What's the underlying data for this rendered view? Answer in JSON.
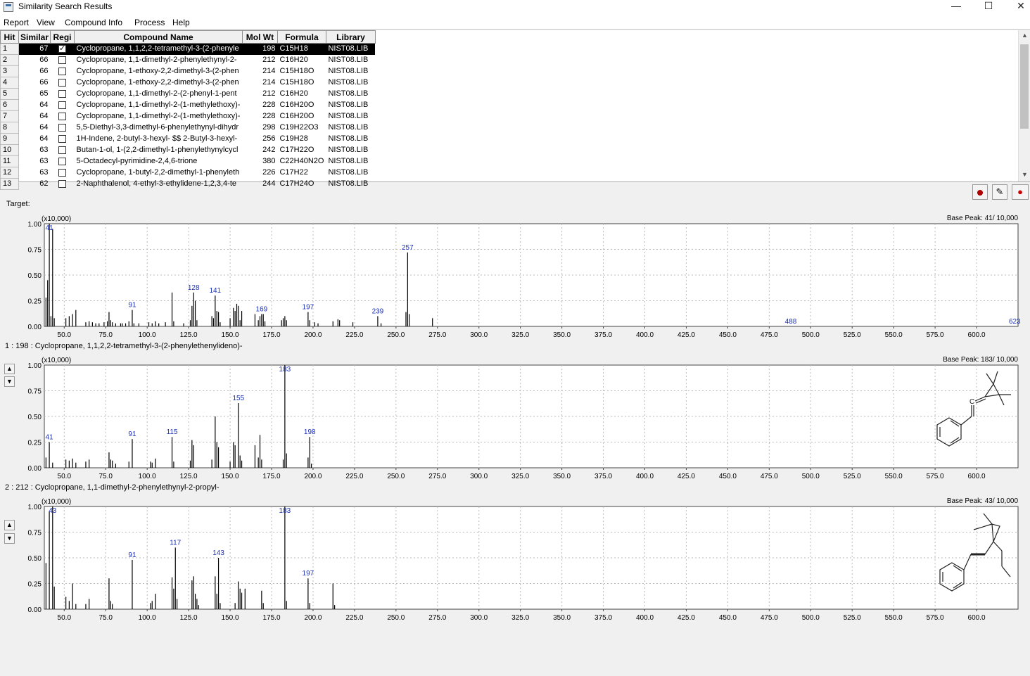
{
  "window": {
    "title": "Similarity Search Results",
    "minimize": "—",
    "maximize": "☐",
    "close": "✕"
  },
  "menu": [
    "Report",
    "View",
    "Compound Info",
    "Process",
    "Help"
  ],
  "table": {
    "columns": [
      "Hit",
      "Similar",
      "Regi",
      "Compound Name",
      "Mol Wt",
      "Formula",
      "Library"
    ],
    "rows": [
      {
        "hit": "1",
        "sim": "67",
        "reg": true,
        "name": "Cyclopropane, 1,1,2,2-tetramethyl-3-(2-phenyle",
        "mw": "198",
        "formula": "C15H18",
        "lib": "NIST08.LIB"
      },
      {
        "hit": "2",
        "sim": "66",
        "reg": false,
        "name": "Cyclopropane, 1,1-dimethyl-2-phenylethynyl-2-",
        "mw": "212",
        "formula": "C16H20",
        "lib": "NIST08.LIB"
      },
      {
        "hit": "3",
        "sim": "66",
        "reg": false,
        "name": "Cyclopropane, 1-ethoxy-2,2-dimethyl-3-(2-phen",
        "mw": "214",
        "formula": "C15H18O",
        "lib": "NIST08.LIB"
      },
      {
        "hit": "4",
        "sim": "66",
        "reg": false,
        "name": "Cyclopropane, 1-ethoxy-2,2-dimethyl-3-(2-phen",
        "mw": "214",
        "formula": "C15H18O",
        "lib": "NIST08.LIB"
      },
      {
        "hit": "5",
        "sim": "65",
        "reg": false,
        "name": "Cyclopropane, 1,1-dimethyl-2-(2-phenyl-1-pent",
        "mw": "212",
        "formula": "C16H20",
        "lib": "NIST08.LIB"
      },
      {
        "hit": "6",
        "sim": "64",
        "reg": false,
        "name": "Cyclopropane, 1,1-dimethyl-2-(1-methylethoxy)-",
        "mw": "228",
        "formula": "C16H20O",
        "lib": "NIST08.LIB"
      },
      {
        "hit": "7",
        "sim": "64",
        "reg": false,
        "name": "Cyclopropane, 1,1-dimethyl-2-(1-methylethoxy)-",
        "mw": "228",
        "formula": "C16H20O",
        "lib": "NIST08.LIB"
      },
      {
        "hit": "8",
        "sim": "64",
        "reg": false,
        "name": "5,5-Diethyl-3,3-dimethyl-6-phenylethynyl-dihydr",
        "mw": "298",
        "formula": "C19H22O3",
        "lib": "NIST08.LIB"
      },
      {
        "hit": "9",
        "sim": "64",
        "reg": false,
        "name": "1H-Indene, 2-butyl-3-hexyl- $$ 2-Butyl-3-hexyl-",
        "mw": "256",
        "formula": "C19H28",
        "lib": "NIST08.LIB"
      },
      {
        "hit": "10",
        "sim": "63",
        "reg": false,
        "name": "Butan-1-ol, 1-(2,2-dimethyl-1-phenylethynylcycl",
        "mw": "242",
        "formula": "C17H22O",
        "lib": "NIST08.LIB"
      },
      {
        "hit": "11",
        "sim": "63",
        "reg": false,
        "name": "5-Octadecyl-pyrimidine-2,4,6-trione",
        "mw": "380",
        "formula": "C22H40N2O",
        "lib": "NIST08.LIB"
      },
      {
        "hit": "12",
        "sim": "63",
        "reg": false,
        "name": "Cyclopropane, 1-butyl-2,2-dimethyl-1-phenyleth",
        "mw": "226",
        "formula": "C17H22",
        "lib": "NIST08.LIB"
      },
      {
        "hit": "13",
        "sim": "62",
        "reg": false,
        "name": "2-Naphthalenol, 4-ethyl-3-ethylidene-1,2,3,4-te",
        "mw": "244",
        "formula": "C17H24O",
        "lib": "NIST08.LIB"
      }
    ]
  },
  "toolbar_icons": [
    "record-icon",
    "edit-icon",
    "molecule-color-icon"
  ],
  "target_label": "Target:",
  "hit1_label": "1 : 198 : Cyclopropane, 1,1,2,2-tetramethyl-3-(2-phenylethenylideno)-",
  "hit2_label": "2 : 212 : Cyclopropane, 1,1-dimethyl-2-phenylethynyl-2-propyl-",
  "chart_data": [
    {
      "type": "bar",
      "name": "target",
      "scale_label": "(x10,000)",
      "base_peak": "Base Peak: 41/ 10,000",
      "xlim": [
        38,
        625
      ],
      "ylim": [
        0,
        1
      ],
      "xticks": [
        "50.0",
        "75.0",
        "100.0",
        "125.0",
        "150.0",
        "175.0",
        "200.0",
        "225.0",
        "250.0",
        "275.0",
        "300.0",
        "325.0",
        "350.0",
        "375.0",
        "400.0",
        "425.0",
        "450.0",
        "475.0",
        "500.0",
        "525.0",
        "550.0",
        "575.0",
        "600.0"
      ],
      "yticks": [
        "0.00",
        "0.25",
        "0.50",
        "0.75",
        "1.00"
      ],
      "peaks": [
        [
          39,
          0.28
        ],
        [
          40,
          0.45
        ],
        [
          41,
          1.0
        ],
        [
          42,
          0.1
        ],
        [
          43,
          0.95
        ],
        [
          44,
          0.08
        ],
        [
          51,
          0.08
        ],
        [
          53,
          0.1
        ],
        [
          55,
          0.12
        ],
        [
          57,
          0.16
        ],
        [
          63,
          0.04
        ],
        [
          65,
          0.05
        ],
        [
          67,
          0.04
        ],
        [
          69,
          0.03
        ],
        [
          71,
          0.03
        ],
        [
          74,
          0.04
        ],
        [
          76,
          0.05
        ],
        [
          77,
          0.14
        ],
        [
          78,
          0.06
        ],
        [
          79,
          0.04
        ],
        [
          81,
          0.03
        ],
        [
          84,
          0.03
        ],
        [
          85,
          0.03
        ],
        [
          87,
          0.03
        ],
        [
          89,
          0.05
        ],
        [
          91,
          0.16
        ],
        [
          92,
          0.03
        ],
        [
          95,
          0.03
        ],
        [
          101,
          0.04
        ],
        [
          103,
          0.03
        ],
        [
          105,
          0.05
        ],
        [
          107,
          0.03
        ],
        [
          111,
          0.04
        ],
        [
          115,
          0.33
        ],
        [
          116,
          0.05
        ],
        [
          122,
          0.03
        ],
        [
          126,
          0.06
        ],
        [
          127,
          0.2
        ],
        [
          128,
          0.33
        ],
        [
          129,
          0.25
        ],
        [
          130,
          0.06
        ],
        [
          139,
          0.1
        ],
        [
          140,
          0.08
        ],
        [
          141,
          0.3
        ],
        [
          142,
          0.15
        ],
        [
          143,
          0.14
        ],
        [
          144,
          0.04
        ],
        [
          150,
          0.08
        ],
        [
          152,
          0.18
        ],
        [
          153,
          0.15
        ],
        [
          154,
          0.22
        ],
        [
          155,
          0.2
        ],
        [
          156,
          0.06
        ],
        [
          157,
          0.15
        ],
        [
          165,
          0.12
        ],
        [
          167,
          0.06
        ],
        [
          168,
          0.1
        ],
        [
          169,
          0.12
        ],
        [
          170,
          0.12
        ],
        [
          171,
          0.05
        ],
        [
          181,
          0.06
        ],
        [
          182,
          0.08
        ],
        [
          183,
          0.1
        ],
        [
          184,
          0.06
        ],
        [
          197,
          0.14
        ],
        [
          198,
          0.06
        ],
        [
          201,
          0.04
        ],
        [
          203,
          0.03
        ],
        [
          212,
          0.05
        ],
        [
          215,
          0.07
        ],
        [
          216,
          0.06
        ],
        [
          224,
          0.04
        ],
        [
          239,
          0.1
        ],
        [
          241,
          0.03
        ],
        [
          256,
          0.14
        ],
        [
          257,
          0.72
        ],
        [
          258,
          0.12
        ],
        [
          272,
          0.08
        ]
      ],
      "annotations": [
        {
          "x": 41,
          "y": 1.0,
          "label": "41"
        },
        {
          "x": 91,
          "y": 0.16,
          "label": "91"
        },
        {
          "x": 128,
          "y": 0.33,
          "label": "128"
        },
        {
          "x": 141,
          "y": 0.3,
          "label": "141"
        },
        {
          "x": 169,
          "y": 0.12,
          "label": "169"
        },
        {
          "x": 197,
          "y": 0.14,
          "label": "197"
        },
        {
          "x": 239,
          "y": 0.1,
          "label": "239"
        },
        {
          "x": 257,
          "y": 0.72,
          "label": "257"
        },
        {
          "x": 488,
          "y": 0.0,
          "label": "488"
        },
        {
          "x": 623,
          "y": 0.0,
          "label": "623"
        }
      ]
    },
    {
      "type": "bar",
      "name": "hit1",
      "scale_label": "(x10,000)",
      "base_peak": "Base Peak: 183/ 10,000",
      "xlim": [
        38,
        625
      ],
      "ylim": [
        0,
        1
      ],
      "xticks": [
        "50.0",
        "75.0",
        "100.0",
        "125.0",
        "150.0",
        "175.0",
        "200.0",
        "225.0",
        "250.0",
        "275.0",
        "300.0",
        "325.0",
        "350.0",
        "375.0",
        "400.0",
        "425.0",
        "450.0",
        "475.0",
        "500.0",
        "525.0",
        "550.0",
        "575.0",
        "600.0"
      ],
      "yticks": [
        "0.00",
        "0.25",
        "0.50",
        "0.75",
        "1.00"
      ],
      "peaks": [
        [
          39,
          0.1
        ],
        [
          41,
          0.25
        ],
        [
          43,
          0.05
        ],
        [
          51,
          0.08
        ],
        [
          53,
          0.07
        ],
        [
          55,
          0.09
        ],
        [
          57,
          0.05
        ],
        [
          63,
          0.06
        ],
        [
          65,
          0.08
        ],
        [
          77,
          0.15
        ],
        [
          78,
          0.08
        ],
        [
          79,
          0.07
        ],
        [
          81,
          0.04
        ],
        [
          89,
          0.06
        ],
        [
          91,
          0.28
        ],
        [
          102,
          0.06
        ],
        [
          103,
          0.05
        ],
        [
          105,
          0.09
        ],
        [
          115,
          0.3
        ],
        [
          116,
          0.06
        ],
        [
          126,
          0.07
        ],
        [
          127,
          0.27
        ],
        [
          128,
          0.22
        ],
        [
          139,
          0.08
        ],
        [
          141,
          0.5
        ],
        [
          142,
          0.25
        ],
        [
          143,
          0.2
        ],
        [
          150,
          0.06
        ],
        [
          152,
          0.25
        ],
        [
          153,
          0.22
        ],
        [
          155,
          0.63
        ],
        [
          156,
          0.12
        ],
        [
          157,
          0.07
        ],
        [
          165,
          0.22
        ],
        [
          167,
          0.1
        ],
        [
          168,
          0.32
        ],
        [
          169,
          0.08
        ],
        [
          182,
          0.08
        ],
        [
          183,
          1.0
        ],
        [
          184,
          0.14
        ],
        [
          197,
          0.1
        ],
        [
          198,
          0.3
        ],
        [
          199,
          0.04
        ]
      ],
      "annotations": [
        {
          "x": 41,
          "y": 0.25,
          "label": "41"
        },
        {
          "x": 91,
          "y": 0.28,
          "label": "91"
        },
        {
          "x": 115,
          "y": 0.3,
          "label": "115"
        },
        {
          "x": 155,
          "y": 0.63,
          "label": "155"
        },
        {
          "x": 183,
          "y": 1.0,
          "label": "183"
        },
        {
          "x": 198,
          "y": 0.3,
          "label": "198"
        }
      ]
    },
    {
      "type": "bar",
      "name": "hit2",
      "scale_label": "(x10,000)",
      "base_peak": "Base Peak: 43/ 10,000",
      "xlim": [
        38,
        625
      ],
      "ylim": [
        0,
        1
      ],
      "xticks": [
        "50.0",
        "75.0",
        "100.0",
        "125.0",
        "150.0",
        "175.0",
        "200.0",
        "225.0",
        "250.0",
        "275.0",
        "300.0",
        "325.0",
        "350.0",
        "375.0",
        "400.0",
        "425.0",
        "450.0",
        "475.0",
        "500.0",
        "525.0",
        "550.0",
        "575.0",
        "600.0"
      ],
      "yticks": [
        "0.00",
        "0.25",
        "0.50",
        "0.75",
        "1.00"
      ],
      "peaks": [
        [
          39,
          0.45
        ],
        [
          41,
          0.95
        ],
        [
          43,
          1.0
        ],
        [
          44,
          0.22
        ],
        [
          51,
          0.12
        ],
        [
          53,
          0.08
        ],
        [
          55,
          0.25
        ],
        [
          57,
          0.05
        ],
        [
          63,
          0.05
        ],
        [
          65,
          0.1
        ],
        [
          77,
          0.3
        ],
        [
          78,
          0.08
        ],
        [
          79,
          0.05
        ],
        [
          91,
          0.48
        ],
        [
          102,
          0.06
        ],
        [
          103,
          0.08
        ],
        [
          105,
          0.15
        ],
        [
          115,
          0.31
        ],
        [
          116,
          0.2
        ],
        [
          117,
          0.6
        ],
        [
          118,
          0.1
        ],
        [
          127,
          0.28
        ],
        [
          128,
          0.32
        ],
        [
          129,
          0.15
        ],
        [
          130,
          0.1
        ],
        [
          131,
          0.04
        ],
        [
          141,
          0.32
        ],
        [
          142,
          0.15
        ],
        [
          143,
          0.5
        ],
        [
          144,
          0.06
        ],
        [
          153,
          0.06
        ],
        [
          155,
          0.27
        ],
        [
          156,
          0.2
        ],
        [
          157,
          0.16
        ],
        [
          159,
          0.2
        ],
        [
          169,
          0.18
        ],
        [
          170,
          0.06
        ],
        [
          183,
          1.0
        ],
        [
          184,
          0.08
        ],
        [
          197,
          0.3
        ],
        [
          198,
          0.06
        ],
        [
          212,
          0.25
        ],
        [
          213,
          0.04
        ]
      ],
      "annotations": [
        {
          "x": 43,
          "y": 1.0,
          "label": "43"
        },
        {
          "x": 91,
          "y": 0.48,
          "label": "91"
        },
        {
          "x": 117,
          "y": 0.6,
          "label": "117"
        },
        {
          "x": 143,
          "y": 0.5,
          "label": "143"
        },
        {
          "x": 183,
          "y": 1.0,
          "label": "183"
        },
        {
          "x": 197,
          "y": 0.3,
          "label": "197"
        }
      ]
    }
  ],
  "structure_atom_label": "C"
}
